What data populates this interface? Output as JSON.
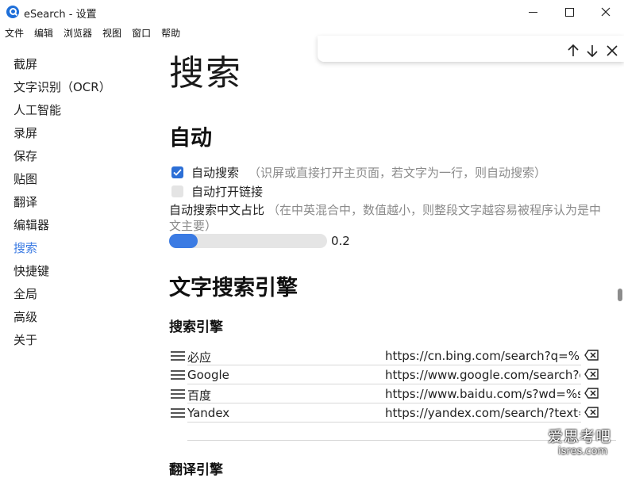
{
  "window": {
    "title": "eSearch - 设置",
    "minimize_icon": "minimize-icon",
    "maximize_icon": "maximize-icon",
    "close_icon": "close-icon"
  },
  "menubar": [
    "文件",
    "编辑",
    "浏览器",
    "视图",
    "窗口",
    "帮助"
  ],
  "sidebar": {
    "items": [
      {
        "label": "截屏",
        "active": false
      },
      {
        "label": "文字识别（OCR）",
        "active": false
      },
      {
        "label": "人工智能",
        "active": false
      },
      {
        "label": "录屏",
        "active": false
      },
      {
        "label": "保存",
        "active": false
      },
      {
        "label": "贴图",
        "active": false
      },
      {
        "label": "翻译",
        "active": false
      },
      {
        "label": "编辑器",
        "active": false
      },
      {
        "label": "搜索",
        "active": true
      },
      {
        "label": "快捷键",
        "active": false
      },
      {
        "label": "全局",
        "active": false
      },
      {
        "label": "高级",
        "active": false
      },
      {
        "label": "关于",
        "active": false
      }
    ],
    "active_color": "#3b7be3"
  },
  "findbar": {
    "up_icon": "arrow-up-icon",
    "down_icon": "arrow-down-icon",
    "close_icon": "close-icon"
  },
  "main": {
    "page_title": "搜索",
    "auto_section": {
      "heading": "自动",
      "auto_search": {
        "label": "自动搜索",
        "hint": "（识屏或直接打开主页面，若文字为一行，则自动搜索）",
        "checked": true
      },
      "auto_open_link": {
        "label": "自动打开链接",
        "checked": false
      },
      "ratio": {
        "label": "自动搜索中文占比",
        "hint": "（在中英混合中，数值越小，则整段文字越容易被程序认为是中文主要）",
        "value": 0.2,
        "value_text": "0.2"
      }
    },
    "engine_section": {
      "heading": "文字搜索引擎",
      "subheading": "搜索引擎",
      "engines": [
        {
          "name": "必应",
          "url": "https://cn.bing.com/search?q=%s"
        },
        {
          "name": "Google",
          "url": "https://www.google.com/search?q=%s"
        },
        {
          "name": "百度",
          "url": "https://www.baidu.com/s?wd=%s"
        },
        {
          "name": "Yandex",
          "url": "https://yandex.com/search/?text=%s"
        }
      ],
      "next_subheading": "翻译引擎"
    }
  },
  "watermark": {
    "line1": "爱思考吧",
    "line2": "isres.com"
  },
  "colors": {
    "accent": "#2c6fd6",
    "slider_fill": "#3b7be3",
    "hint": "#8a8a8a"
  }
}
